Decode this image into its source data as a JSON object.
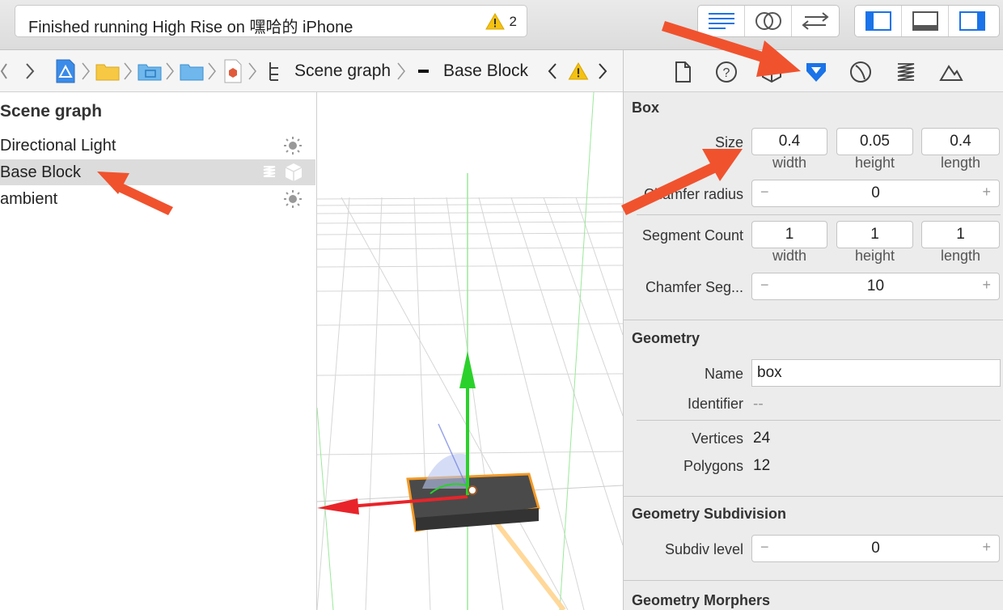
{
  "toolbar": {
    "status_text": "Finished running High Rise on 嘿哈的 iPhone",
    "warning_count": "2"
  },
  "jumpbar": {
    "crumb_scene_graph": "Scene graph",
    "crumb_selected": "Base Block"
  },
  "outline": {
    "title": "Scene graph",
    "items": [
      {
        "label": "Directional Light",
        "icon": "sun-icon"
      },
      {
        "label": "Base Block",
        "icon": "cube-icon"
      },
      {
        "label": "ambient",
        "icon": "sun-icon"
      }
    ]
  },
  "inspector": {
    "box": {
      "title": "Box",
      "size_label": "Size",
      "size": {
        "width": "0.4",
        "height": "0.05",
        "length": "0.4"
      },
      "sub_width": "width",
      "sub_height": "height",
      "sub_length": "length",
      "chamfer_radius_label": "Chamfer radius",
      "chamfer_radius": "0",
      "segment_count_label": "Segment Count",
      "segment_count": {
        "width": "1",
        "height": "1",
        "length": "1"
      },
      "chamfer_seg_label": "Chamfer Seg...",
      "chamfer_seg": "10",
      "minus": "−",
      "plus": "+"
    },
    "geometry": {
      "title": "Geometry",
      "name_label": "Name",
      "name": "box",
      "identifier_label": "Identifier",
      "identifier": "--",
      "vertices_label": "Vertices",
      "vertices": "24",
      "polygons_label": "Polygons",
      "polygons": "12"
    },
    "subdivision": {
      "title": "Geometry Subdivision",
      "level_label": "Subdiv level",
      "level": "0"
    },
    "morphers": {
      "title": "Geometry Morphers"
    }
  },
  "colors": {
    "accent_blue": "#1a73e8",
    "annotation_arrow": "#f0522e",
    "axis_green": "#2bd12b",
    "axis_red": "#e8242a",
    "selection_orange": "#f39a26"
  }
}
